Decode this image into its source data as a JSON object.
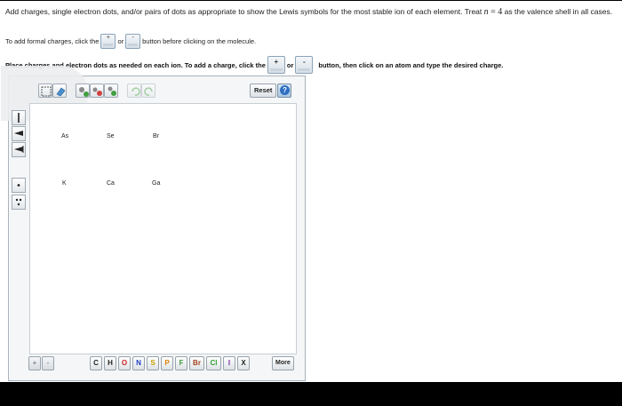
{
  "instructions": {
    "line1_a": "Add charges, single electron dots, and/or pairs of dots as appropriate to show the Lewis symbols for the most stable ion of each element. Treat ",
    "line1_n": "n",
    "line1_eq": " = 4",
    "line1_b": " as the valence shell in all cases.",
    "line2_a": "To add formal charges, click the",
    "line2_or": "or",
    "line2_b": "button before clicking on the molecule.",
    "line3_a": "Place charges and electron dots as needed on each ion. To add a charge, click the",
    "line3_or": "or",
    "line3_b": "button, then click on an atom and type the desired charge.",
    "plus_symbol": "+",
    "minus_symbol": "-"
  },
  "editor": {
    "reset_label": "Reset",
    "help_label": "?",
    "atoms": [
      "As",
      "Se",
      "Br",
      "K",
      "Ca",
      "Ga"
    ],
    "bottom": {
      "plus": "+",
      "minus": "-",
      "elements": [
        {
          "symbol": "C",
          "color": "#222222"
        },
        {
          "symbol": "H",
          "color": "#222222"
        },
        {
          "symbol": "O",
          "color": "#d02020"
        },
        {
          "symbol": "N",
          "color": "#2040c0"
        },
        {
          "symbol": "S",
          "color": "#c8a000"
        },
        {
          "symbol": "P",
          "color": "#e08000"
        },
        {
          "symbol": "F",
          "color": "#40a040"
        },
        {
          "symbol": "Br",
          "color": "#a04020"
        },
        {
          "symbol": "Cl",
          "color": "#30a030"
        },
        {
          "symbol": "I",
          "color": "#8030a0"
        },
        {
          "symbol": "X",
          "color": "#222222"
        }
      ],
      "more_label": "More"
    }
  },
  "icons": [
    "select-icon",
    "eraser-icon",
    "copy-icon",
    "cut-icon",
    "paste-icon",
    "undo-icon",
    "redo-icon",
    "help-icon",
    "single-bond-icon",
    "double-bond-icon",
    "triple-bond-icon",
    "single-dot-icon",
    "electron-pair-icon"
  ]
}
